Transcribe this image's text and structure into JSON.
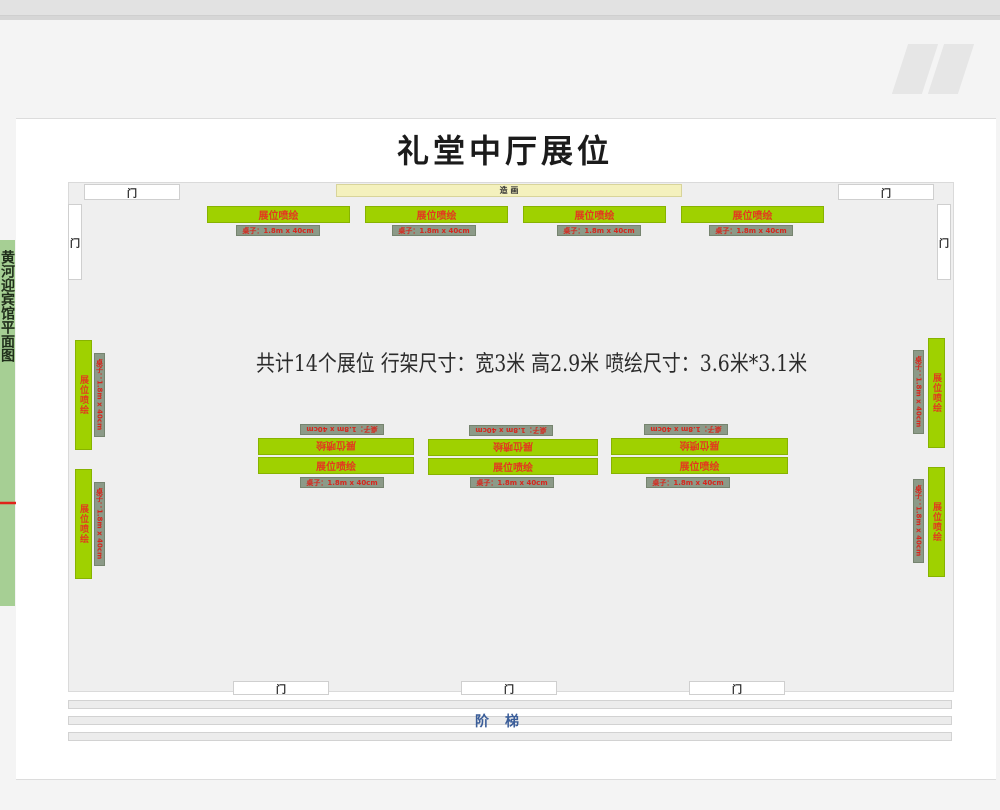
{
  "title": "礼堂中厅展位",
  "side_title": "黄河迎宾馆平面图",
  "info": "共计14个展位 行架尺寸：宽3米 高2.9米  喷绘尺寸：3.6米*3.1米",
  "banner": "造 画",
  "stairs": "阶梯",
  "door": "门",
  "booth_label": "展位喷绘",
  "table_label": "桌子：1.8m x 40cm",
  "colors": {
    "booth_green": "#9fd100",
    "booth_text": "#e23a1f",
    "table_gray": "#8c9a88",
    "stairs_blue": "#3a5d99",
    "banner_yellow": "#f4f1bd"
  }
}
